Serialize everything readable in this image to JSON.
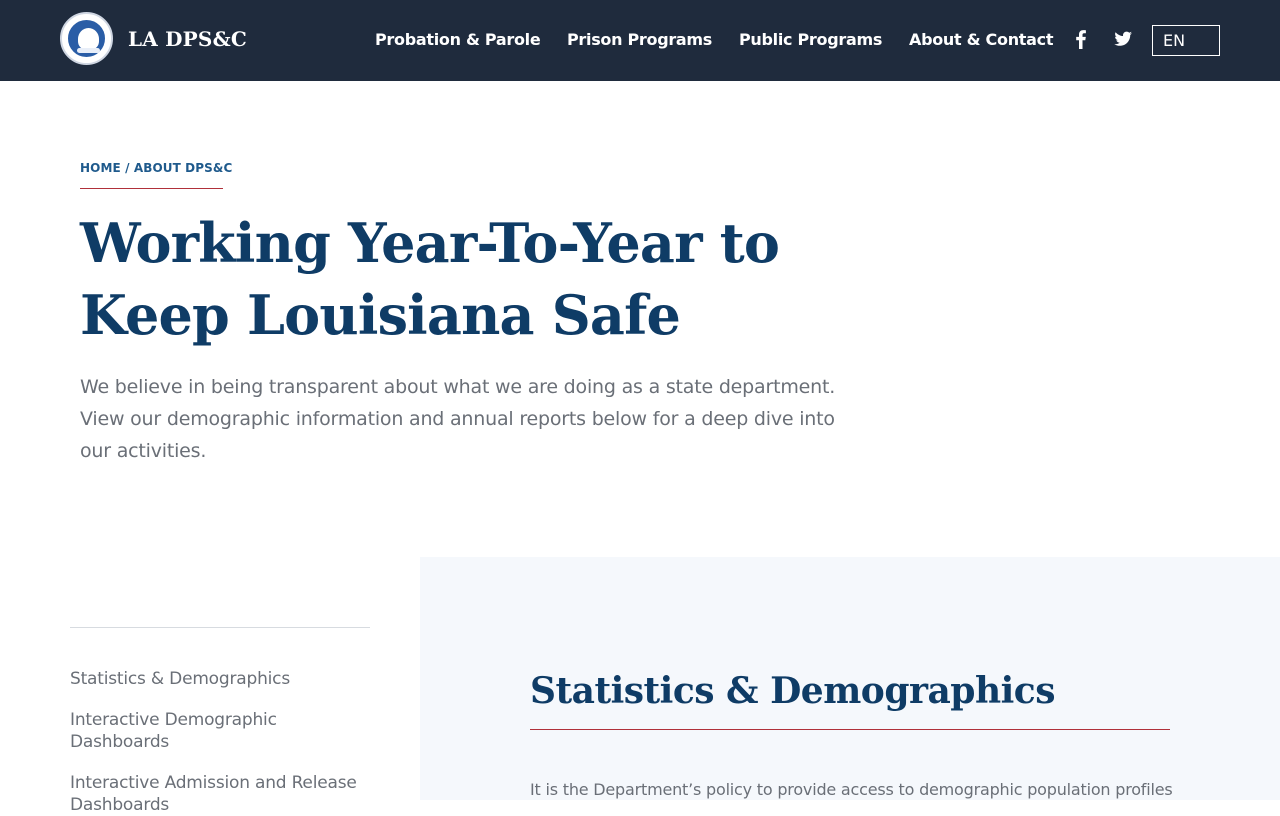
{
  "header": {
    "brand": "LA DPS&C",
    "nav": [
      {
        "label": "Probation & Parole"
      },
      {
        "label": "Prison Programs"
      },
      {
        "label": "Public Programs"
      },
      {
        "label": "About & Contact"
      }
    ],
    "social": [
      {
        "icon": "facebook-icon"
      },
      {
        "icon": "twitter-icon"
      }
    ],
    "language": "EN",
    "colors": {
      "background": "#1f2b3d",
      "text": "#ffffff"
    }
  },
  "breadcrumb": {
    "home": "HOME",
    "separator": "/",
    "current": "ABOUT DPS&C"
  },
  "hero": {
    "title": "Working Year-To-Year to Keep Louisiana Safe",
    "body": "We believe in being transparent about what we are doing as a state department. View our demographic information and annual reports below for a deep dive into our activities."
  },
  "sidebar": {
    "items": [
      {
        "label": "Statistics & Demographics"
      },
      {
        "label": "Interactive Demographic Dashboards"
      },
      {
        "label": "Interactive Admission and Release Dashboards"
      }
    ]
  },
  "content": {
    "title": "Statistics & Demographics",
    "body": "It is the Department’s policy to provide access to demographic population profiles"
  },
  "colors": {
    "heading": "#0f3c66",
    "accent_rule": "#b0303a",
    "breadcrumb_link": "#1f5a8c",
    "body_text": "#6a6f77",
    "panel_background": "#f5f8fc"
  }
}
